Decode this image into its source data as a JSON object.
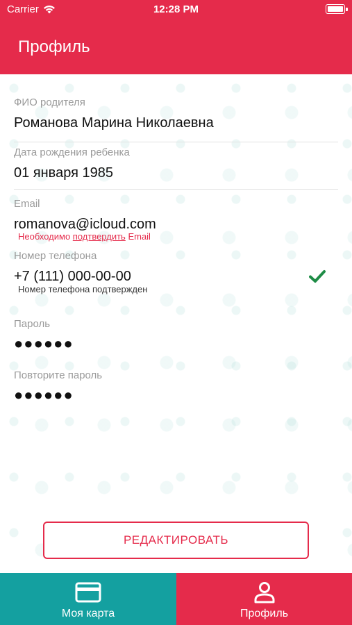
{
  "status": {
    "carrier": "Carrier",
    "time": "12:28 PM"
  },
  "header": {
    "title": "Профиль"
  },
  "fields": {
    "parent_name": {
      "label": "ФИО родителя",
      "value": "Романова Марина Николаевна"
    },
    "child_birthdate": {
      "label": "Дата рождения ребенка",
      "value": "01 января 1985"
    },
    "email": {
      "label": "Email",
      "value": "romanova@icloud.com",
      "note_prefix": "Необходимо ",
      "note_link": "подтвердить",
      "note_suffix": " Email"
    },
    "phone": {
      "label": "Номер телефона",
      "value": "+7 (111) 000-00-00",
      "note": "Номер телефона подтвержден",
      "verified_icon": "checkmark-icon"
    },
    "password": {
      "label": "Пароль",
      "value": "●●●●●●"
    },
    "password_repeat": {
      "label": "Повторите пароль",
      "value": "●●●●●●"
    }
  },
  "actions": {
    "edit_label": "РЕДАКТИРОВАТЬ"
  },
  "tabbar": {
    "items": [
      {
        "label": "Моя карта",
        "icon": "card-icon"
      },
      {
        "label": "Профиль",
        "icon": "person-icon"
      }
    ]
  },
  "colors": {
    "accent": "#e52b4b",
    "teal": "#14a0a0",
    "success": "#1e8c46"
  }
}
